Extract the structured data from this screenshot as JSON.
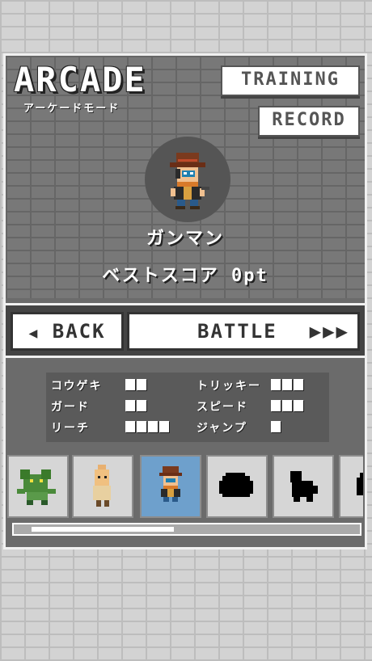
{
  "header": {
    "title": "ARCADE",
    "subtitle": "アーケードモード",
    "training_label": "TRAINING",
    "record_label": "RECORD"
  },
  "character": {
    "name": "ガンマン",
    "best_score": "ベストスコア 0pt"
  },
  "actions": {
    "back_arrow": "◀",
    "back_label": "BACK",
    "battle_label": "BATTLE",
    "battle_arrows": "▶▶▶"
  },
  "stats": [
    {
      "label": "コウゲキ",
      "level": 2
    },
    {
      "label": "トリッキー",
      "level": 3
    },
    {
      "label": "ガード",
      "level": 2
    },
    {
      "label": "スピード",
      "level": 3
    },
    {
      "label": "リーチ",
      "level": 4
    },
    {
      "label": "ジャンプ",
      "level": 1
    }
  ],
  "roster": {
    "selected_index": 2,
    "scroll_fraction": 0.4,
    "cards": [
      {
        "icon": "green-lizard-sprite"
      },
      {
        "icon": "bald-fighter-sprite"
      },
      {
        "icon": "gunman-sprite"
      },
      {
        "icon": "locked-silhouette"
      },
      {
        "icon": "locked-silhouette"
      },
      {
        "icon": "locked-silhouette"
      }
    ]
  },
  "colors": {
    "selected_card": "#6ea0cc",
    "panel": "#6b6b6b"
  }
}
